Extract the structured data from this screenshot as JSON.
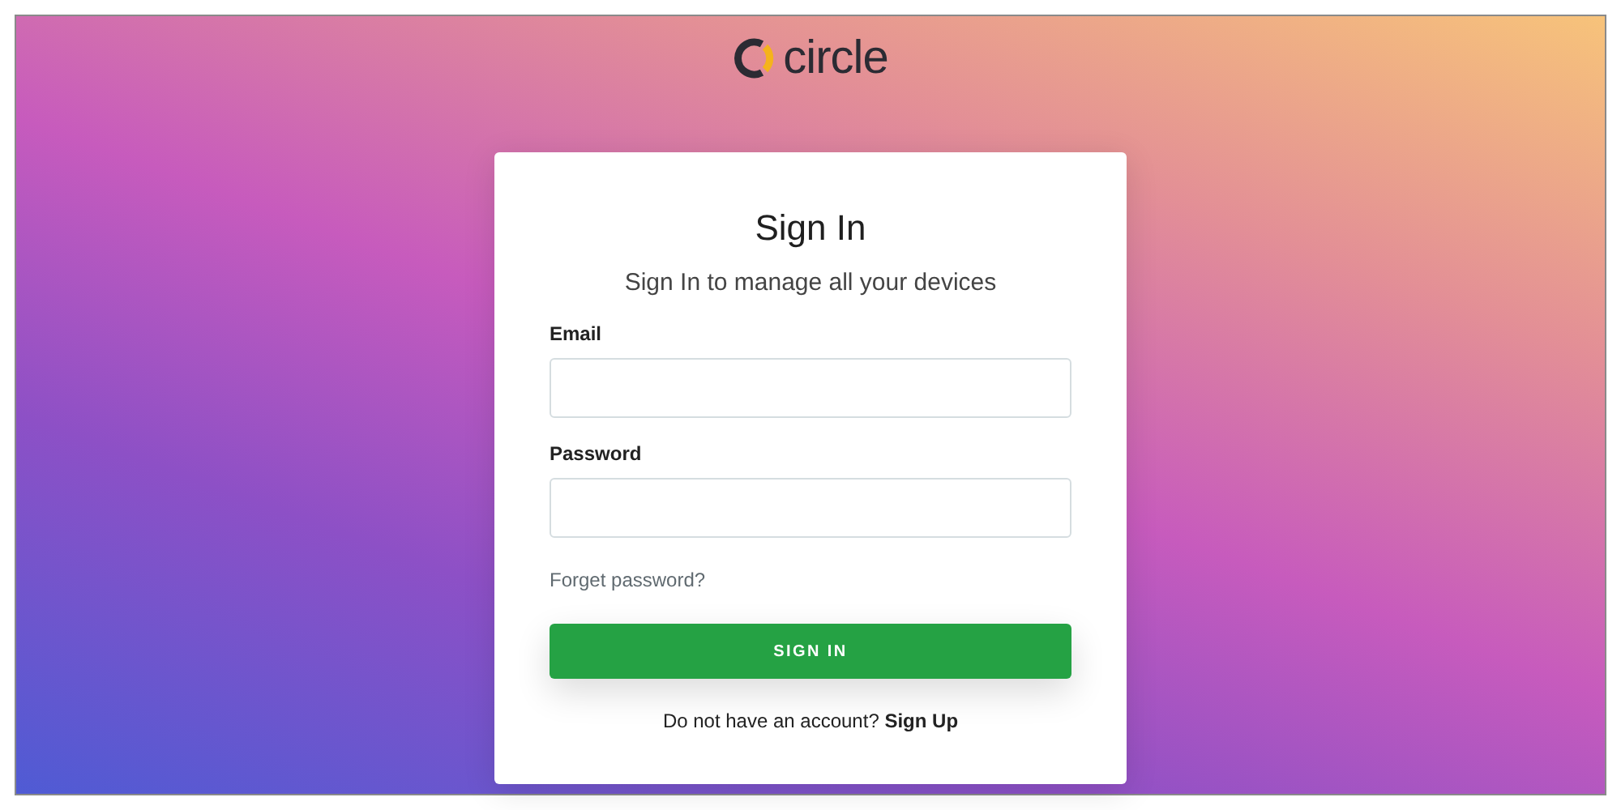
{
  "logo": {
    "text": "circle"
  },
  "card": {
    "title": "Sign In",
    "subtitle": "Sign In to manage all your devices",
    "fields": [
      {
        "label": "Email"
      },
      {
        "label": "Password"
      }
    ],
    "forgot_link": "Forget password?",
    "submit_button": "SIGN IN",
    "signup_prompt": "Do not have an account?",
    "signup_link": "Sign Up"
  }
}
